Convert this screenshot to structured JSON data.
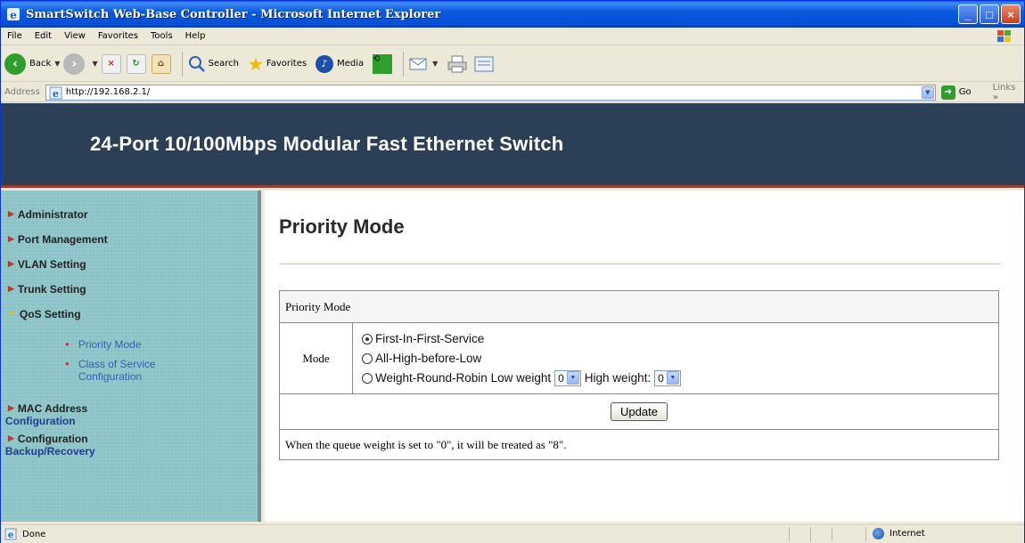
{
  "window": {
    "title": "SmartSwitch Web-Base Controller - Microsoft Internet Explorer",
    "controls": {
      "minimize": "_",
      "maximize": "□",
      "close": "×"
    }
  },
  "menu": [
    "File",
    "Edit",
    "View",
    "Favorites",
    "Tools",
    "Help"
  ],
  "toolbar": {
    "back": "Back",
    "search": "Search",
    "favorites": "Favorites",
    "media": "Media"
  },
  "address": {
    "label": "Address",
    "url": "http://192.168.2.1/",
    "go": "Go",
    "links": "Links"
  },
  "banner": {
    "title": "24-Port 10/100Mbps Modular Fast Ethernet Switch"
  },
  "nav": {
    "items": [
      {
        "label": "Administrator"
      },
      {
        "label": "Port Management"
      },
      {
        "label": "VLAN Setting"
      },
      {
        "label": "Trunk Setting"
      },
      {
        "label": "QoS Setting"
      }
    ],
    "sub": [
      {
        "label": "Priority Mode"
      },
      {
        "label": "Class of Service"
      },
      {
        "label": "Configuration"
      }
    ],
    "mac": {
      "line1": "MAC Address",
      "line2": "Configuration"
    },
    "config": {
      "line1": "Configuration",
      "line2": "Backup/Recovery"
    }
  },
  "main": {
    "page_title": "Priority Mode",
    "table_header": "Priority Mode",
    "mode_label": "Mode",
    "options": [
      {
        "label": "First-In-First-Service",
        "selected": true
      },
      {
        "label": "All-High-before-Low",
        "selected": false
      },
      {
        "label": "Weight-Round-Robin Low weight",
        "selected": false
      }
    ],
    "low_weight": "0",
    "high_weight_label": "High weight:",
    "high_weight": "0",
    "update_button": "Update",
    "note": "When the queue weight is set to \"0\", it will be treated as \"8\"."
  },
  "status": {
    "text": "Done",
    "zone": "Internet"
  }
}
